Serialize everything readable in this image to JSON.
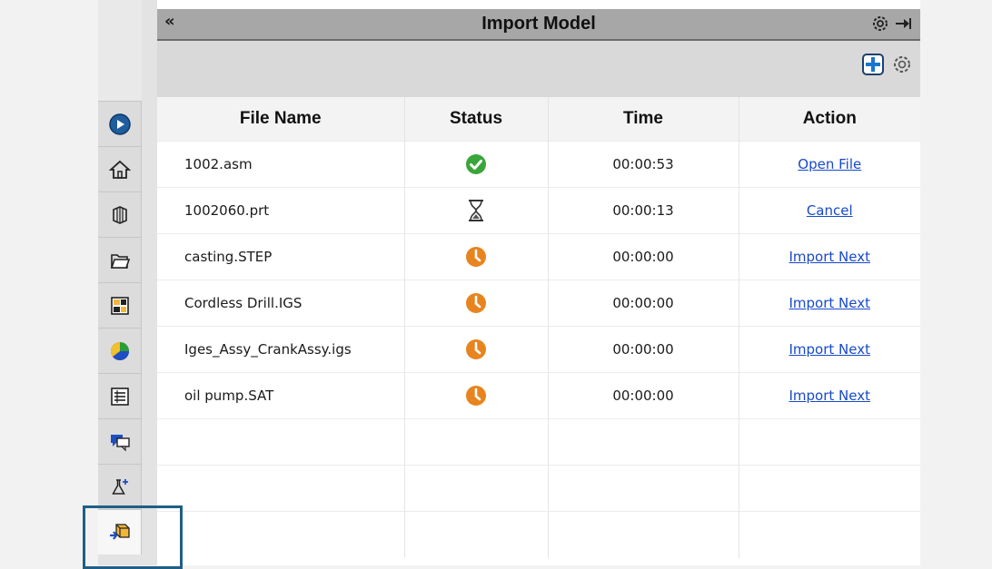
{
  "panel": {
    "title": "Import Model",
    "collapse_glyph": "«"
  },
  "titlebar_icons": [
    "gear-icon",
    "pin-icon"
  ],
  "toolbar_icons": [
    "add-icon",
    "settings-icon"
  ],
  "sidebar": {
    "tabs": [
      {
        "name": "tab-3d-view",
        "icon": "globe-play-icon"
      },
      {
        "name": "tab-home",
        "icon": "home-icon"
      },
      {
        "name": "tab-parts",
        "icon": "parts-library-icon"
      },
      {
        "name": "tab-files",
        "icon": "folder-icon"
      },
      {
        "name": "tab-view-palette",
        "icon": "view-palette-icon"
      },
      {
        "name": "tab-appearances",
        "icon": "color-sphere-icon"
      },
      {
        "name": "tab-properties",
        "icon": "custom-properties-icon"
      },
      {
        "name": "tab-forum",
        "icon": "chat-icon"
      },
      {
        "name": "tab-simulation",
        "icon": "flask-sparkle-icon"
      },
      {
        "name": "tab-import-model",
        "icon": "import-cube-icon",
        "active": true
      }
    ]
  },
  "table": {
    "headers": {
      "name": "File Name",
      "status": "Status",
      "time": "Time",
      "action": "Action"
    },
    "rows": [
      {
        "file": "1002.asm",
        "status": "done",
        "time": "00:00:53",
        "action": "Open File"
      },
      {
        "file": "1002060.prt",
        "status": "in-progress",
        "time": "00:00:13",
        "action": "Cancel"
      },
      {
        "file": "casting.STEP",
        "status": "pending",
        "time": "00:00:00",
        "action": "Import Next"
      },
      {
        "file": "Cordless Drill.IGS",
        "status": "pending",
        "time": "00:00:00",
        "action": "Import Next"
      },
      {
        "file": "Iges_Assy_CrankAssy.igs",
        "status": "pending",
        "time": "00:00:00",
        "action": "Import Next"
      },
      {
        "file": "oil pump.SAT",
        "status": "pending",
        "time": "00:00:00",
        "action": "Import Next"
      }
    ],
    "empty_rows": 3
  },
  "colors": {
    "done": "#3aa53a",
    "pending": "#e8841f",
    "link": "#1749c9",
    "titlebar": "#a7a7a7",
    "focus_box": "#1f5f86"
  }
}
